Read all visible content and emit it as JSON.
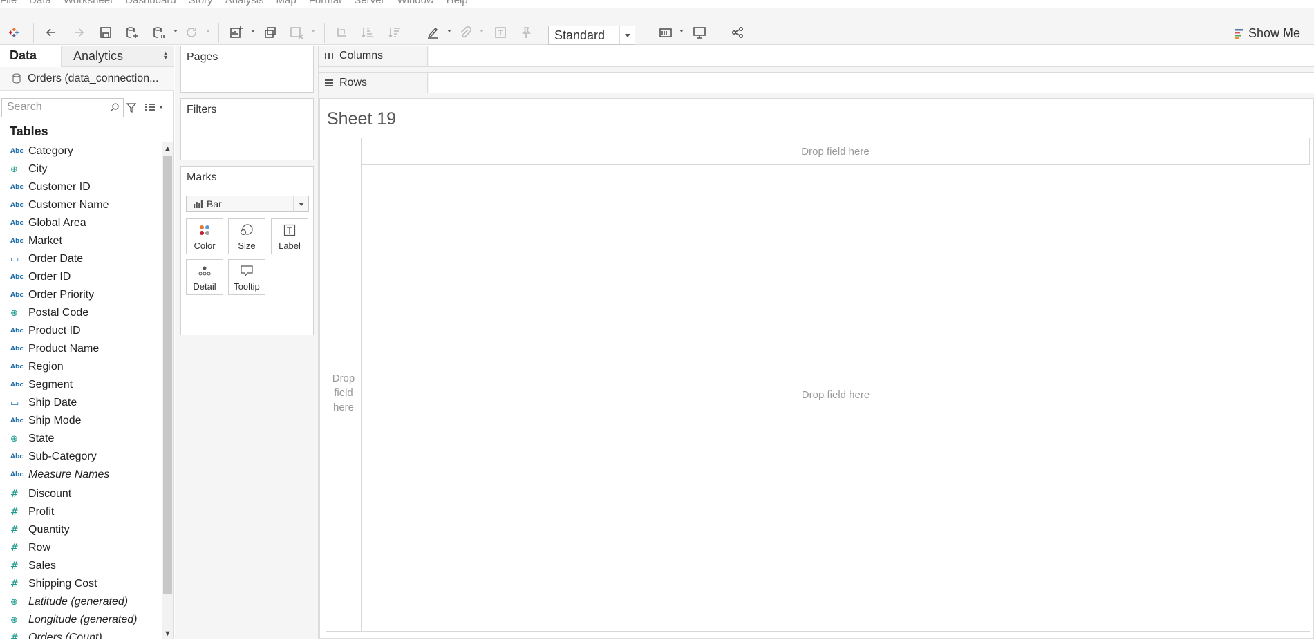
{
  "menu": [
    "File",
    "Data",
    "Worksheet",
    "Dashboard",
    "Story",
    "Analysis",
    "Map",
    "Format",
    "Server",
    "Window",
    "Help"
  ],
  "toolbar": {
    "fit_value": "Standard",
    "show_me_label": "Show Me"
  },
  "data_pane": {
    "tab_data": "Data",
    "tab_analytics": "Analytics",
    "datasource": "Orders (data_connection...",
    "search_placeholder": "Search",
    "tables_heading": "Tables",
    "dimensions": [
      {
        "name": "Category",
        "type": "Abc"
      },
      {
        "name": "City",
        "type": "geo"
      },
      {
        "name": "Customer ID",
        "type": "Abc"
      },
      {
        "name": "Customer Name",
        "type": "Abc"
      },
      {
        "name": "Global Area",
        "type": "Abc"
      },
      {
        "name": "Market",
        "type": "Abc"
      },
      {
        "name": "Order Date",
        "type": "date"
      },
      {
        "name": "Order ID",
        "type": "Abc"
      },
      {
        "name": "Order Priority",
        "type": "Abc"
      },
      {
        "name": "Postal Code",
        "type": "geo"
      },
      {
        "name": "Product ID",
        "type": "Abc"
      },
      {
        "name": "Product Name",
        "type": "Abc"
      },
      {
        "name": "Region",
        "type": "Abc"
      },
      {
        "name": "Segment",
        "type": "Abc"
      },
      {
        "name": "Ship Date",
        "type": "date"
      },
      {
        "name": "Ship Mode",
        "type": "Abc"
      },
      {
        "name": "State",
        "type": "geo"
      },
      {
        "name": "Sub-Category",
        "type": "Abc"
      },
      {
        "name": "Measure Names",
        "type": "Abc",
        "italic": true
      }
    ],
    "measures": [
      {
        "name": "Discount",
        "type": "num"
      },
      {
        "name": "Profit",
        "type": "num"
      },
      {
        "name": "Quantity",
        "type": "num"
      },
      {
        "name": "Row",
        "type": "num"
      },
      {
        "name": "Sales",
        "type": "num"
      },
      {
        "name": "Shipping Cost",
        "type": "num"
      },
      {
        "name": "Latitude (generated)",
        "type": "geo",
        "italic": true
      },
      {
        "name": "Longitude (generated)",
        "type": "geo",
        "italic": true
      },
      {
        "name": "Orders (Count)",
        "type": "num",
        "italic": true
      }
    ]
  },
  "cards": {
    "pages": "Pages",
    "filters": "Filters",
    "marks": "Marks",
    "mark_type": "Bar",
    "mark_buttons": {
      "color": "Color",
      "size": "Size",
      "label": "Label",
      "detail": "Detail",
      "tooltip": "Tooltip"
    }
  },
  "shelves": {
    "columns": "Columns",
    "rows": "Rows"
  },
  "view": {
    "sheet_title": "Sheet 19",
    "col_drop": "Drop field here",
    "row_drop": "Drop field here",
    "center_drop": "Drop field here"
  },
  "colors": {
    "accent_blue": "#1f6fab",
    "accent_teal": "#1a9a8d",
    "border": "#dcdcdc"
  }
}
